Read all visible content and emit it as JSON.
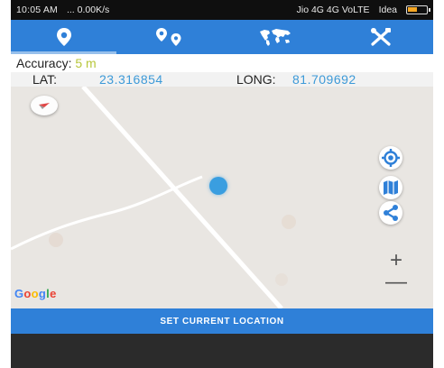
{
  "status_bar": {
    "time": "10:05 AM",
    "network_speed": "... 0.00K/s",
    "carrier_text": "Jio 4G 4G VoLTE",
    "carrier2": "Idea"
  },
  "tabs": [
    {
      "name": "location",
      "icon": "map-pin-icon",
      "active": true
    },
    {
      "name": "multiple-locations",
      "icon": "multi-pin-icon",
      "active": false
    },
    {
      "name": "world-map",
      "icon": "world-map-icon",
      "active": false
    },
    {
      "name": "tools",
      "icon": "tools-icon",
      "active": false
    }
  ],
  "info": {
    "accuracy_label": "Accuracy:",
    "accuracy_value": "5 m",
    "lat_label": "LAT:",
    "lat_value": "23.316854",
    "long_label": "LONG:",
    "long_value": "81.709692"
  },
  "map": {
    "attribution": "Google",
    "zoom_in": "+",
    "zoom_out": "—"
  },
  "action": {
    "set_location_label": "SET CURRENT LOCATION"
  },
  "colors": {
    "primary": "#2f80d8",
    "accuracy": "#b7c63a",
    "coordinate": "#3d9ad8",
    "location_dot": "#3a9ee0"
  }
}
